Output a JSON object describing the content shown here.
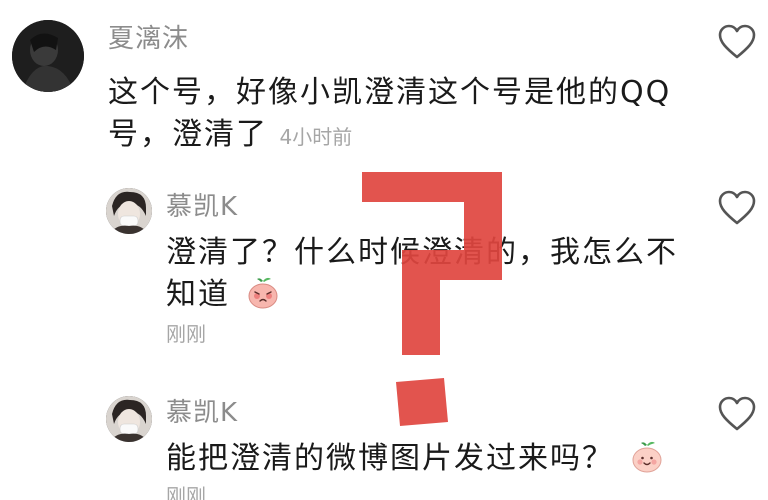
{
  "comments": [
    {
      "username": "夏漓沫",
      "text_line1": "这个号，好像小凯澄清这个号是他的QQ",
      "text_line2": "号，澄清了",
      "time": "4小时前"
    },
    {
      "username": "慕凯K",
      "text_line1": "澄清了？什么时候澄清的，我怎么不",
      "text_line2": "知道",
      "time": "刚刚"
    },
    {
      "username": "慕凯K",
      "text_line1": "能把澄清的微博图片发过来吗？",
      "time": "刚刚"
    }
  ],
  "icons": {
    "like": "heart-outline-icon",
    "emoji_blush": "blushing-peach-emoji",
    "emoji_smile": "smiling-peach-emoji",
    "overlay": "red-question-mark-overlay"
  },
  "colors": {
    "username": "#8c8c8c",
    "text": "#1a1a1a",
    "time": "#a6a6a6",
    "question_mark": "#e0453f"
  }
}
